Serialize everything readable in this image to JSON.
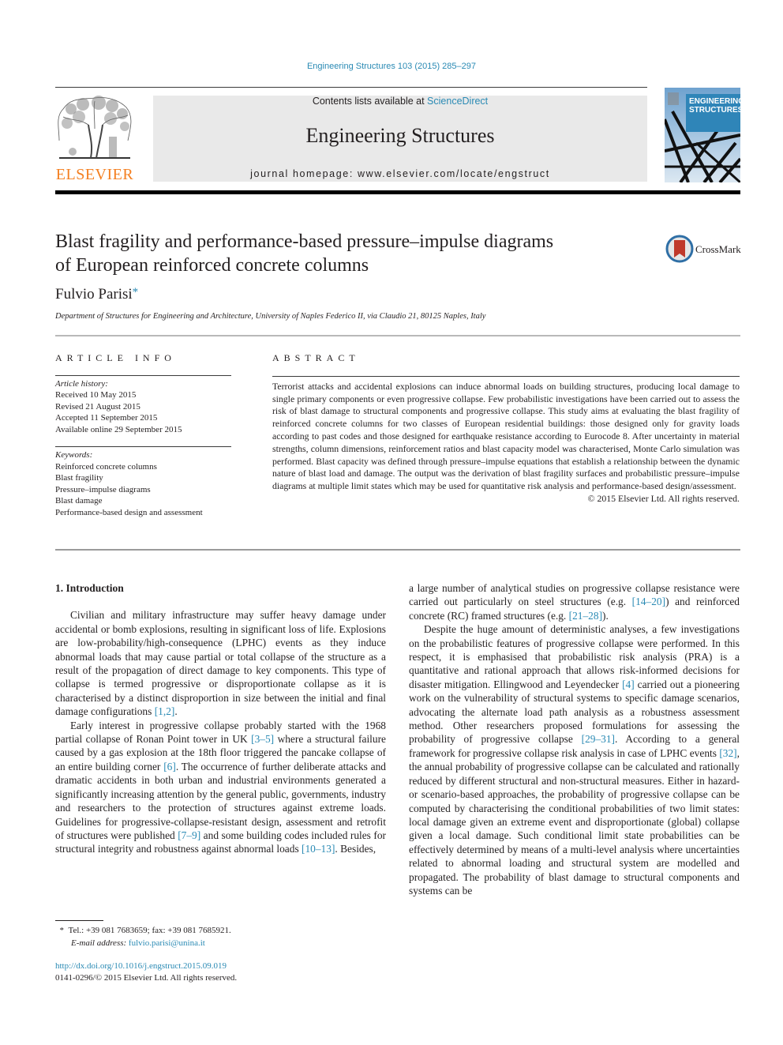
{
  "running_head": "Engineering Structures 103 (2015) 285–297",
  "header": {
    "publisher_logo_label": "ELSEVIER",
    "contents_prefix": "Contents lists available at ",
    "contents_link": "ScienceDirect",
    "journal_name": "Engineering Structures",
    "homepage_prefix": "journal homepage: ",
    "homepage_url": "www.elsevier.com/locate/engstruct",
    "cover_title_line1": "ENGINEERING",
    "cover_title_line2": "STRUCTURES"
  },
  "colors": {
    "link": "#2a8ab4",
    "elsevier_orange": "#f47f20",
    "banner_bg": "#e9e9e9",
    "crossmark_red": "#c0392b"
  },
  "article": {
    "title_line1": "Blast fragility and performance-based pressure–impulse diagrams",
    "title_line2": "of European reinforced concrete columns",
    "crossmark_label": "CrossMark",
    "author": "Fulvio Parisi",
    "author_mark": "*",
    "affiliation": "Department of Structures for Engineering and Architecture, University of Naples Federico II, via Claudio 21, 80125 Naples, Italy"
  },
  "article_info": {
    "heading": "ARTICLE INFO",
    "history_heading": "Article history:",
    "history": [
      "Received 10 May 2015",
      "Revised 21 August 2015",
      "Accepted 11 September 2015",
      "Available online 29 September 2015"
    ],
    "keywords_heading": "Keywords:",
    "keywords": [
      "Reinforced concrete columns",
      "Blast fragility",
      "Pressure–impulse diagrams",
      "Blast damage",
      "Performance-based design and assessment"
    ]
  },
  "abstract": {
    "heading": "ABSTRACT",
    "text": "Terrorist attacks and accidental explosions can induce abnormal loads on building structures, producing local damage to single primary components or even progressive collapse. Few probabilistic investigations have been carried out to assess the risk of blast damage to structural components and progressive collapse. This study aims at evaluating the blast fragility of reinforced concrete columns for two classes of European residential buildings: those designed only for gravity loads according to past codes and those designed for earthquake resistance according to Eurocode 8. After uncertainty in material strengths, column dimensions, reinforcement ratios and blast capacity model was characterised, Monte Carlo simulation was performed. Blast capacity was defined through pressure–impulse equations that establish a relationship between the dynamic nature of blast load and damage. The output was the derivation of blast fragility surfaces and probabilistic pressure–impulse diagrams at multiple limit states which may be used for quantitative risk analysis and performance-based design/assessment.",
    "copyright": "© 2015 Elsevier Ltd. All rights reserved."
  },
  "body": {
    "section_heading": "1. Introduction",
    "left": {
      "p1_text": "Civilian and military infrastructure may suffer heavy damage under accidental or bomb explosions, resulting in significant loss of life. Explosions are low-probability/high-consequence (LPHC) events as they induce abnormal loads that may cause partial or total collapse of the structure as a result of the propagation of direct damage to key components. This type of collapse is termed progressive or disproportionate collapse as it is characterised by a distinct disproportion in size between the initial and final damage configurations ",
      "p1_ref": "[1,2]",
      "p1_end": ".",
      "p2_a": "Early interest in progressive collapse probably started with the 1968 partial collapse of Ronan Point tower in UK ",
      "p2_ref1": "[3–5]",
      "p2_b": " where a structural failure caused by a gas explosion at the 18th floor triggered the pancake collapse of an entire building corner ",
      "p2_ref2": "[6]",
      "p2_c": ". The occurrence of further deliberate attacks and dramatic accidents in both urban and industrial environments generated a significantly increasing attention by the general public, governments, industry and researchers to the protection of structures against extreme loads. Guidelines for progressive-collapse-resistant design, assessment and retrofit of structures were published ",
      "p2_ref3": "[7–9]",
      "p2_d": " and some building codes included rules for structural integrity and robustness against abnormal loads ",
      "p2_ref4": "[10–13]",
      "p2_e": ". Besides,"
    },
    "right": {
      "p1_a": "a large number of analytical studies on progressive collapse resistance were carried out particularly on steel structures (e.g. ",
      "p1_ref1": "[14–20]",
      "p1_b": ") and reinforced concrete (RC) framed structures (e.g. ",
      "p1_ref2": "[21–28]",
      "p1_c": ").",
      "p2_a": "Despite the huge amount of deterministic analyses, a few investigations on the probabilistic features of progressive collapse were performed. In this respect, it is emphasised that probabilistic risk analysis (PRA) is a quantitative and rational approach that allows risk-informed decisions for disaster mitigation. Ellingwood and Leyendecker ",
      "p2_ref1": "[4]",
      "p2_b": " carried out a pioneering work on the vulnerability of structural systems to specific damage scenarios, advocating the alternate load path analysis as a robustness assessment method. Other researchers proposed formulations for assessing the probability of progressive collapse ",
      "p2_ref2": "[29–31]",
      "p2_c": ". According to a general framework for progressive collapse risk analysis in case of LPHC events ",
      "p2_ref3": "[32]",
      "p2_d": ", the annual probability of progressive collapse can be calculated and rationally reduced by different structural and non-structural measures. Either in hazard- or scenario-based approaches, the probability of progressive collapse can be computed by characterising the conditional probabilities of two limit states: local damage given an extreme event and disproportionate (global) collapse given a local damage. Such conditional limit state probabilities can be effectively determined by means of a multi-level analysis where uncertainties related to abnormal loading and structural system are modelled and propagated. The probability of blast damage to structural components and systems can be"
    }
  },
  "footnote": {
    "mark": "*",
    "contact": "Tel.: +39 081 7683659; fax: +39 081 7685921.",
    "email_label": "E-mail address: ",
    "email": "fulvio.parisi@unina.it"
  },
  "doi": {
    "url": "http://dx.doi.org/10.1016/j.engstruct.2015.09.019",
    "issn_line": "0141-0296/© 2015 Elsevier Ltd. All rights reserved."
  }
}
